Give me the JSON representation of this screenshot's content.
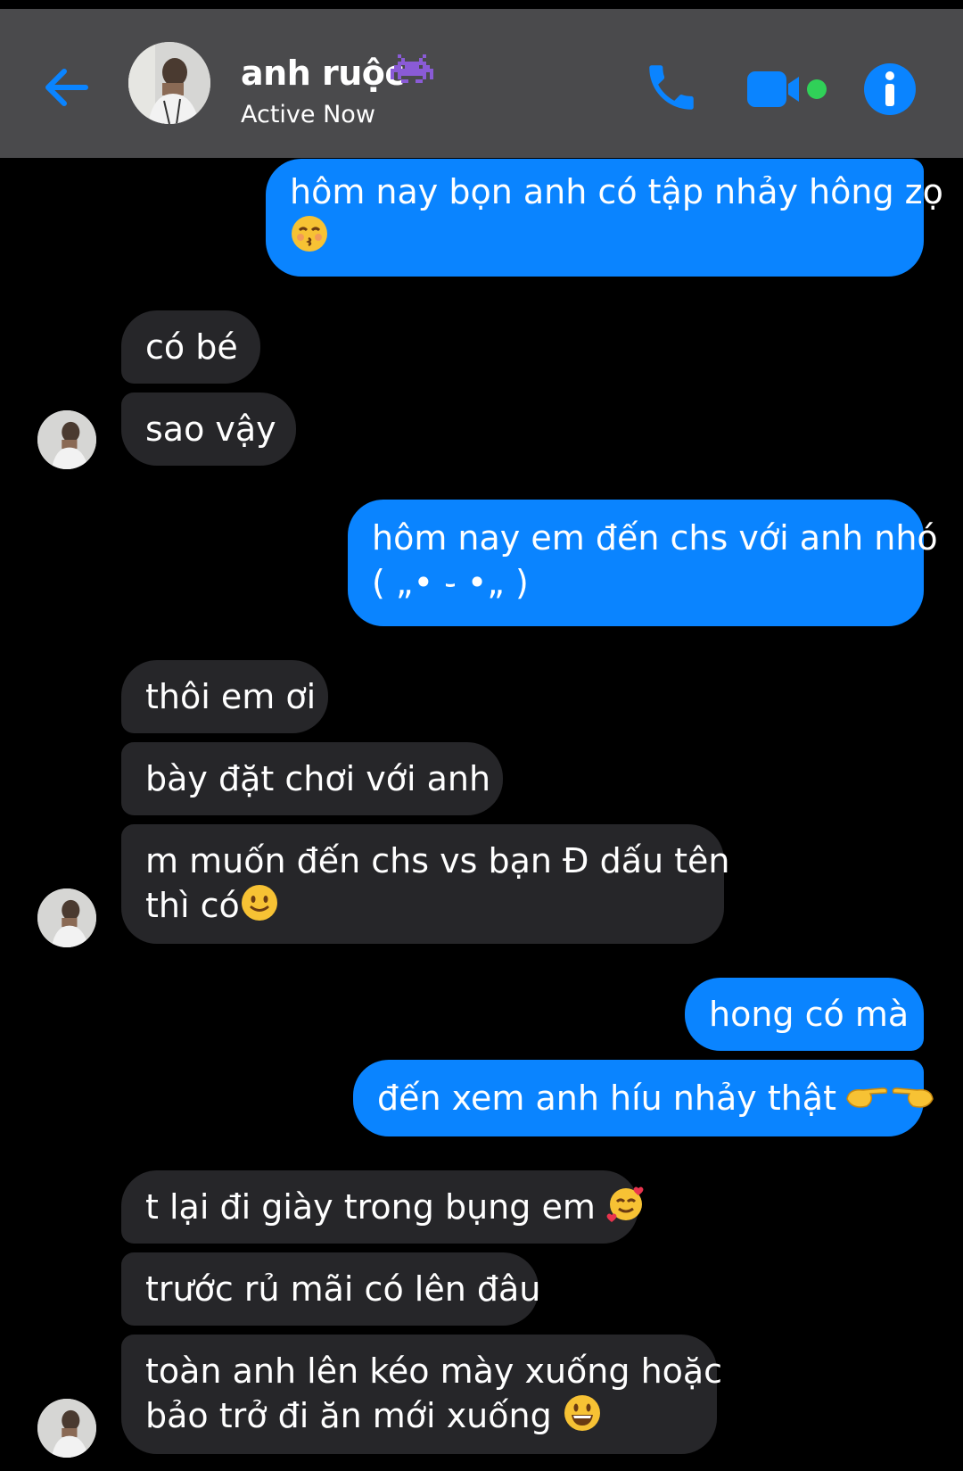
{
  "header": {
    "contact_name": "anh ruộc",
    "status": "Active Now",
    "name_emoji": "alien-monster-icon"
  },
  "colors": {
    "accent": "#0a84ff",
    "header_bg": "#4a4a4c",
    "incoming_bubble": "#262629",
    "active_dot": "#30d158"
  },
  "messages": [
    {
      "dir": "out",
      "lines": [
        "hôm nay bọn anh có tập nhảy hông zọ"
      ],
      "emoji": "kissing-face-icon"
    },
    {
      "dir": "in",
      "lines": [
        "có bé"
      ]
    },
    {
      "dir": "in",
      "lines": [
        "sao vậy"
      ]
    },
    {
      "dir": "out",
      "lines": [
        "hôm nay em đến chs với anh nhó",
        "( „• ֊ •„ )"
      ]
    },
    {
      "dir": "in",
      "lines": [
        "thôi em ơi"
      ]
    },
    {
      "dir": "in",
      "lines": [
        "bày đặt chơi với anh"
      ]
    },
    {
      "dir": "in",
      "lines": [
        "m muốn đến chs vs bạn Đ dấu tên",
        "thì có"
      ],
      "emoji": "slightly-smiling-face-icon"
    },
    {
      "dir": "out",
      "lines": [
        "hong có mà"
      ]
    },
    {
      "dir": "out",
      "lines": [
        "đến xem anh híu nhảy thật"
      ],
      "emoji": "pointing-hands-icon"
    },
    {
      "dir": "in",
      "lines": [
        "t lại đi giày trong bụng em"
      ],
      "emoji": "smiling-face-with-hearts-icon"
    },
    {
      "dir": "in",
      "lines": [
        "trước rủ mãi có lên đâu"
      ]
    },
    {
      "dir": "in",
      "lines": [
        "toàn anh lên kéo mày xuống hoặc",
        "bảo trở đi ăn mới xuống"
      ],
      "emoji": "grinning-face-icon"
    }
  ]
}
